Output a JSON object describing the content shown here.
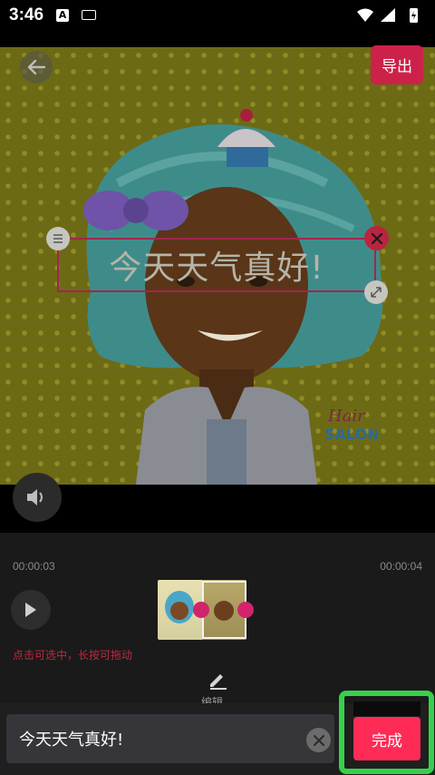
{
  "status_bar": {
    "time": "3:46",
    "notification_icon": "A"
  },
  "preview": {
    "export_label": "导出",
    "overlay_text": "今天天气真好!"
  },
  "timeline": {
    "start_time": "00:00:03",
    "end_time": "00:00:04",
    "hint": "点击可选中，长按可拖动",
    "edit_label": "编辑"
  },
  "input": {
    "value": "今天天气真好!"
  },
  "done_label": "完成",
  "colors": {
    "accent": "#ff2b57",
    "highlight_frame": "#38d04b",
    "text_box_border": "#a1264f",
    "hint_text": "#c0283e"
  }
}
